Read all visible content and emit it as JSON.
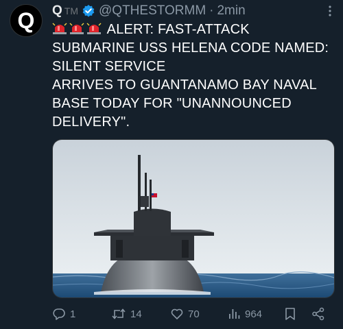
{
  "tweet": {
    "avatar_letter": "Q",
    "name": "Q",
    "badge": "TM",
    "handle": "@QTHESTORMM",
    "separator": "·",
    "time": "2min",
    "lines": [
      "ALERT: FAST-ATTACK",
      "SUBMARINE USS HELENA CODE NAMED:",
      "SILENT SERVICE",
      "ARRIVES TO GUANTANAMO BAY NAVAL",
      "BASE TODAY FOR \"UNANNOUNCED",
      "DELIVERY\"."
    ],
    "emoji": [
      "siren-icon",
      "siren-icon",
      "siren-icon"
    ],
    "image": "photo of a submarine surfaced at sea with a flag on its sail"
  },
  "actions": {
    "replies": "1",
    "retweets": "14",
    "likes": "70",
    "views": "964"
  },
  "colors": {
    "background": "#15202b",
    "text": "#e7e9ea",
    "muted": "#8b98a5",
    "verified": "#1d9bf0"
  }
}
